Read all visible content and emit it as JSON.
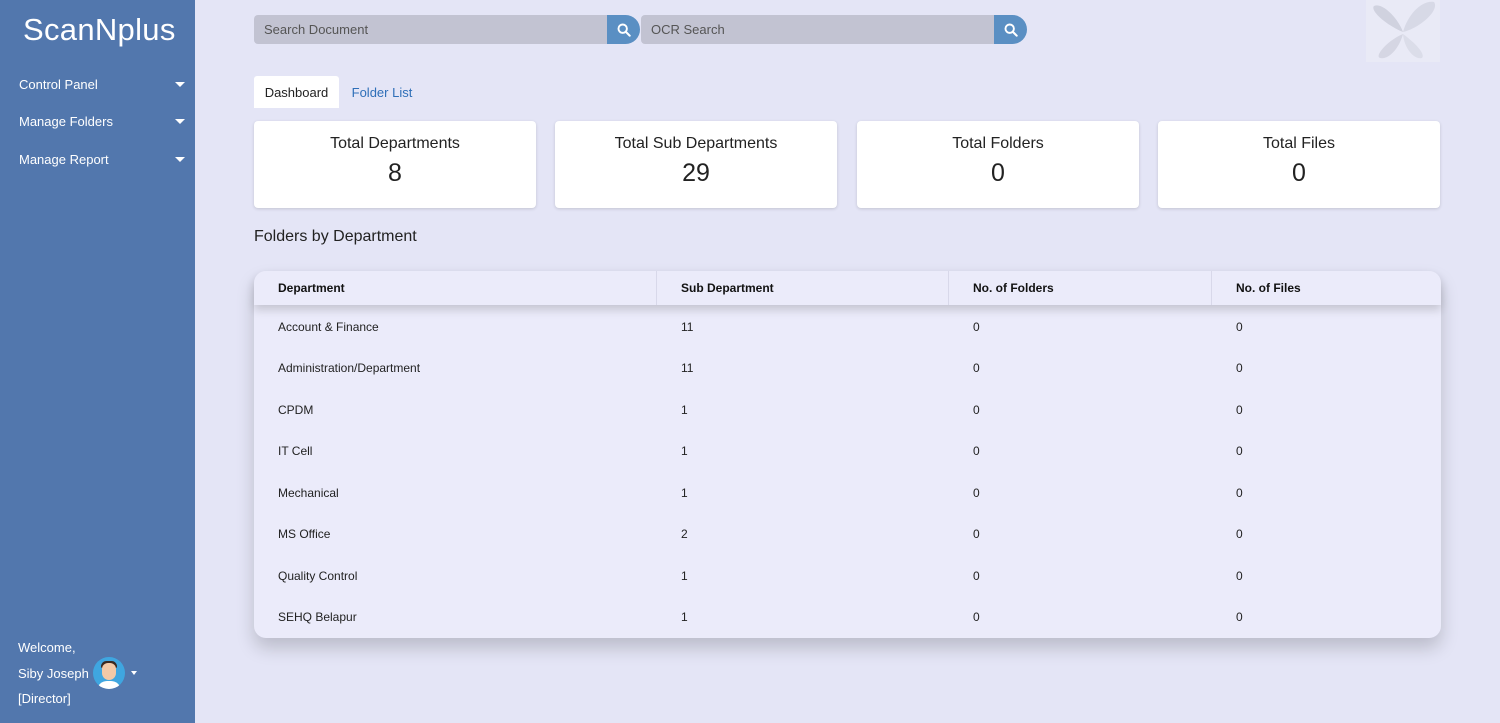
{
  "app": {
    "brand": "ScanNplus"
  },
  "sidebar": {
    "items": [
      {
        "label": "Control Panel"
      },
      {
        "label": "Manage Folders"
      },
      {
        "label": "Manage Report"
      }
    ],
    "user": {
      "welcome": "Welcome,",
      "name": "Siby Joseph",
      "role": "[Director]"
    }
  },
  "search": {
    "document_placeholder": "Search Document",
    "ocr_placeholder": "OCR Search"
  },
  "tabs": [
    {
      "label": "Dashboard",
      "active": true
    },
    {
      "label": "Folder List",
      "active": false
    }
  ],
  "cards": [
    {
      "label": "Total Departments",
      "value": "8"
    },
    {
      "label": "Total Sub Departments",
      "value": "29"
    },
    {
      "label": "Total Folders",
      "value": "0"
    },
    {
      "label": "Total Files",
      "value": "0"
    }
  ],
  "section": {
    "title": "Folders by Department"
  },
  "table": {
    "headers": [
      "Department",
      "Sub Department",
      "No. of Folders",
      "No. of Files"
    ],
    "rows": [
      [
        "Account & Finance",
        "11",
        "0",
        "0"
      ],
      [
        "Administration/Department",
        "11",
        "0",
        "0"
      ],
      [
        "CPDM",
        "1",
        "0",
        "0"
      ],
      [
        "IT Cell",
        "1",
        "0",
        "0"
      ],
      [
        "Mechanical",
        "1",
        "0",
        "0"
      ],
      [
        "MS Office",
        "2",
        "0",
        "0"
      ],
      [
        "Quality Control",
        "1",
        "0",
        "0"
      ],
      [
        "SEHQ Belapur",
        "1",
        "0",
        "0"
      ]
    ]
  },
  "colors": {
    "sidebar": "#5277ad",
    "page_bg": "#e4e5f6",
    "search_button": "#5a8fc3",
    "link": "#2f6fb8"
  },
  "icons": [
    "search-icon",
    "chevron-down-icon",
    "user-avatar",
    "scannplus-logo"
  ]
}
